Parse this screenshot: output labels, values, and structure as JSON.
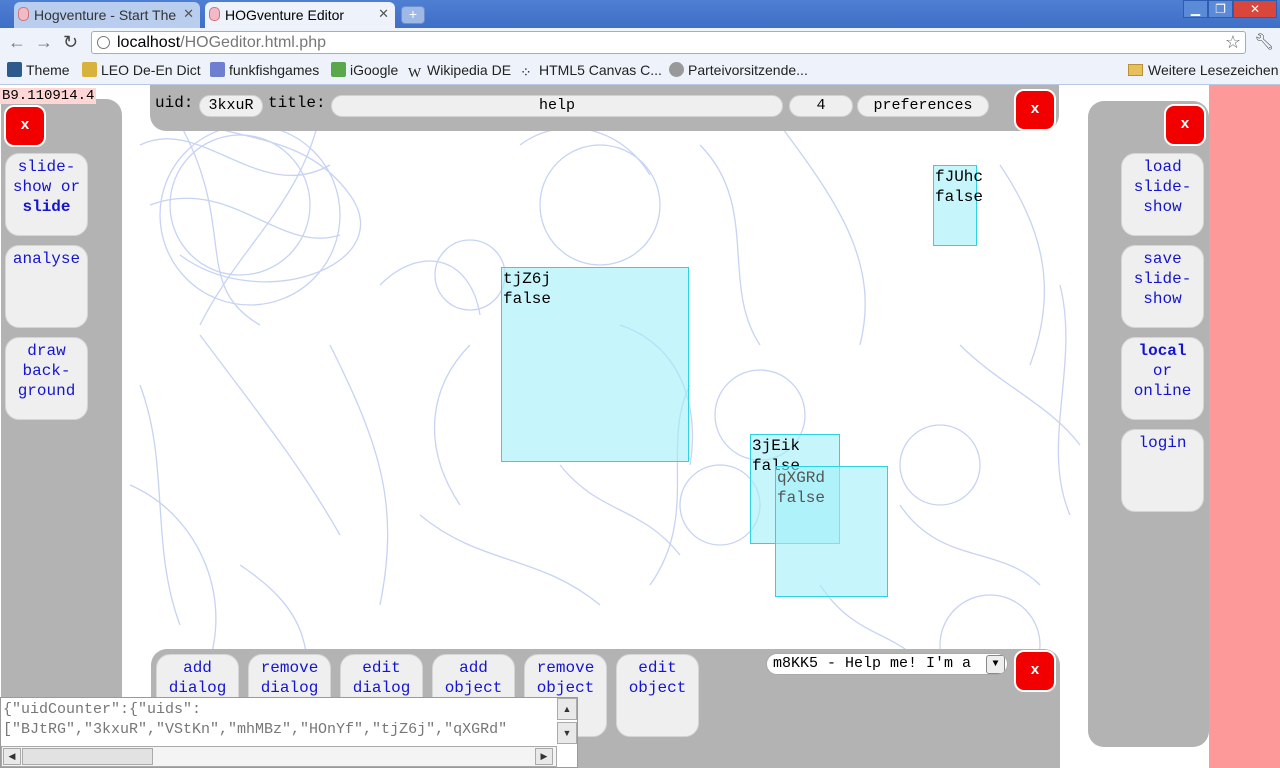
{
  "browser": {
    "tabs": [
      {
        "title": "Hogventure - Start The",
        "active": false
      },
      {
        "title": "HOGventure Editor",
        "active": true
      }
    ],
    "url_host": "localhost",
    "url_path": "/HOGeditor.html.php",
    "bookmarks": [
      "Theme",
      "LEO De-En Dict",
      "funkfishgames",
      "iGoogle",
      "Wikipedia DE",
      "HTML5 Canvas C...",
      "Parteivorsitzende..."
    ],
    "bookmarks_other": "Weitere Lesezeichen"
  },
  "editor": {
    "version": "B9.110914.4",
    "uid_label": "uid:",
    "uid_value": "3kxuR",
    "title_label": "title:",
    "title_value": "help",
    "slide_number": "4",
    "preferences_label": "preferences",
    "close_label": "x",
    "left_buttons": [
      {
        "line1": "slide-",
        "line2": "show or",
        "line3": "slide"
      },
      {
        "line1": "analyse"
      },
      {
        "line1": "draw",
        "line2": "back-",
        "line3": "ground"
      }
    ],
    "right_buttons": [
      {
        "line1": "load",
        "line2": "slide-",
        "line3": "show"
      },
      {
        "line1": "save",
        "line2": "slide-",
        "line3": "show"
      },
      {
        "line1": "local",
        "line2": "or",
        "line3": "online"
      },
      {
        "line1": "login"
      }
    ],
    "bottom_buttons": [
      {
        "line1": "add",
        "line2": "dialog"
      },
      {
        "line1": "remove",
        "line2": "dialog"
      },
      {
        "line1": "edit",
        "line2": "dialog"
      },
      {
        "line1": "add",
        "line2": "object"
      },
      {
        "line1": "remove",
        "line2": "object"
      },
      {
        "line1": "edit",
        "line2": "object"
      }
    ],
    "dialog_select_value": "m8KK5 - Help me! I'm a",
    "objects": [
      {
        "uid": "fJUhc",
        "state": "false"
      },
      {
        "uid": "tjZ6j",
        "state": "false"
      },
      {
        "uid": "3jEik",
        "state": "false"
      },
      {
        "uid": "qXGRd",
        "state": "false"
      }
    ],
    "json_dump_line1": "{\"uidCounter\":{\"uids\":",
    "json_dump_line2": "[\"BJtRG\",\"3kxuR\",\"VStKn\",\"mhMBz\",\"HOnYf\",\"tjZ6j\",\"qXGRd\""
  },
  "colors": {
    "panel": "#b3b3b3",
    "button_text": "#1515d0",
    "close_button": "#f20000",
    "object_fill": "#a0f0f8",
    "right_strip": "#fe9999"
  }
}
